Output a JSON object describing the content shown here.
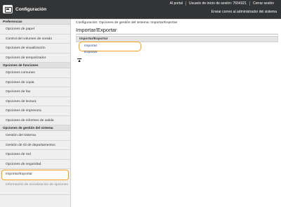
{
  "header": {
    "title": "Configuración",
    "links": [
      "Al portal",
      "Usuario de inicio de sesión: 7654321",
      "Cerrar sesión"
    ],
    "mail_link": "Enviar correo al administrador del sistema"
  },
  "sidebar": {
    "sections": [
      {
        "header": "Preferencias",
        "items": [
          "Opciones de papel",
          "Control del volumen de sonido",
          "Opciones de visualización",
          "Opciones de temporizador"
        ]
      },
      {
        "header": "Opciones de funciones",
        "items": [
          "Opciones comunes",
          "Opciones de copia",
          "Opciones de fax",
          "Opciones de lectura",
          "Opciones de impresora",
          "Opciones de informes de salida"
        ]
      },
      {
        "header": "Opciones de gestión del sistema",
        "items": [
          "Gestión del sistema",
          "Gestión de ID de departamentos",
          "Opciones de red",
          "Opciones de seguridad",
          "Importar/Exportar",
          "Información de inicialización de opciones"
        ]
      }
    ]
  },
  "main": {
    "breadcrumb": "Configuración: Opciones de gestión del sistema: Importar/Exportar",
    "title": "Importar/Exportar",
    "panel_header": "Importar/Exportar",
    "options": [
      "Importar",
      "Exportar"
    ]
  },
  "colors": {
    "highlight": "#f0a020",
    "topbar": "#333436",
    "link": "#2b4a8c"
  }
}
